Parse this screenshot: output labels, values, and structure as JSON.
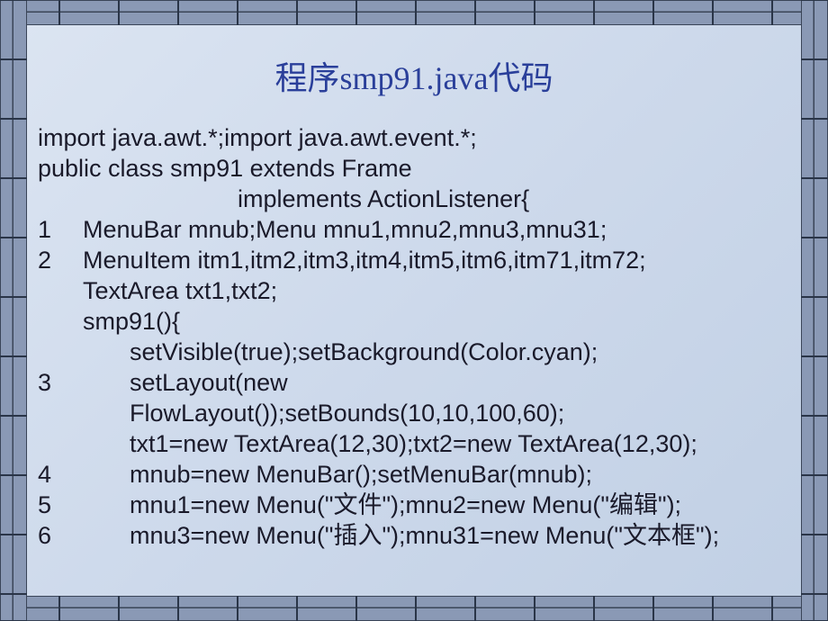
{
  "title": "程序smp91.java代码",
  "code": {
    "l1": "import java.awt.*;import java.awt.event.*;",
    "l2": "public class smp91 extends Frame",
    "l3": "implements ActionListener{",
    "n1": "1",
    "c1": "MenuBar mnub;Menu mnu1,mnu2,mnu3,mnu31;",
    "n2": "2",
    "c2": "MenuItem itm1,itm2,itm3,itm4,itm5,itm6,itm71,itm72;",
    "c3": "TextArea txt1,txt2;",
    "c4": "smp91(){",
    "c5": "setVisible(true);setBackground(Color.cyan);",
    "n3": "3",
    "c6a": "setLayout(new",
    "c6b": "FlowLayout());setBounds(10,10,100,60);",
    "c7": "txt1=new TextArea(12,30);txt2=new TextArea(12,30);",
    "n4": "4",
    "c8": "mnub=new MenuBar();setMenuBar(mnub);",
    "n5": "5",
    "c9": "mnu1=new Menu(\"文件\");mnu2=new Menu(\"编辑\");",
    "n6": "6",
    "c10": "mnu3=new Menu(\"插入\");mnu31=new Menu(\"文本框\");"
  }
}
